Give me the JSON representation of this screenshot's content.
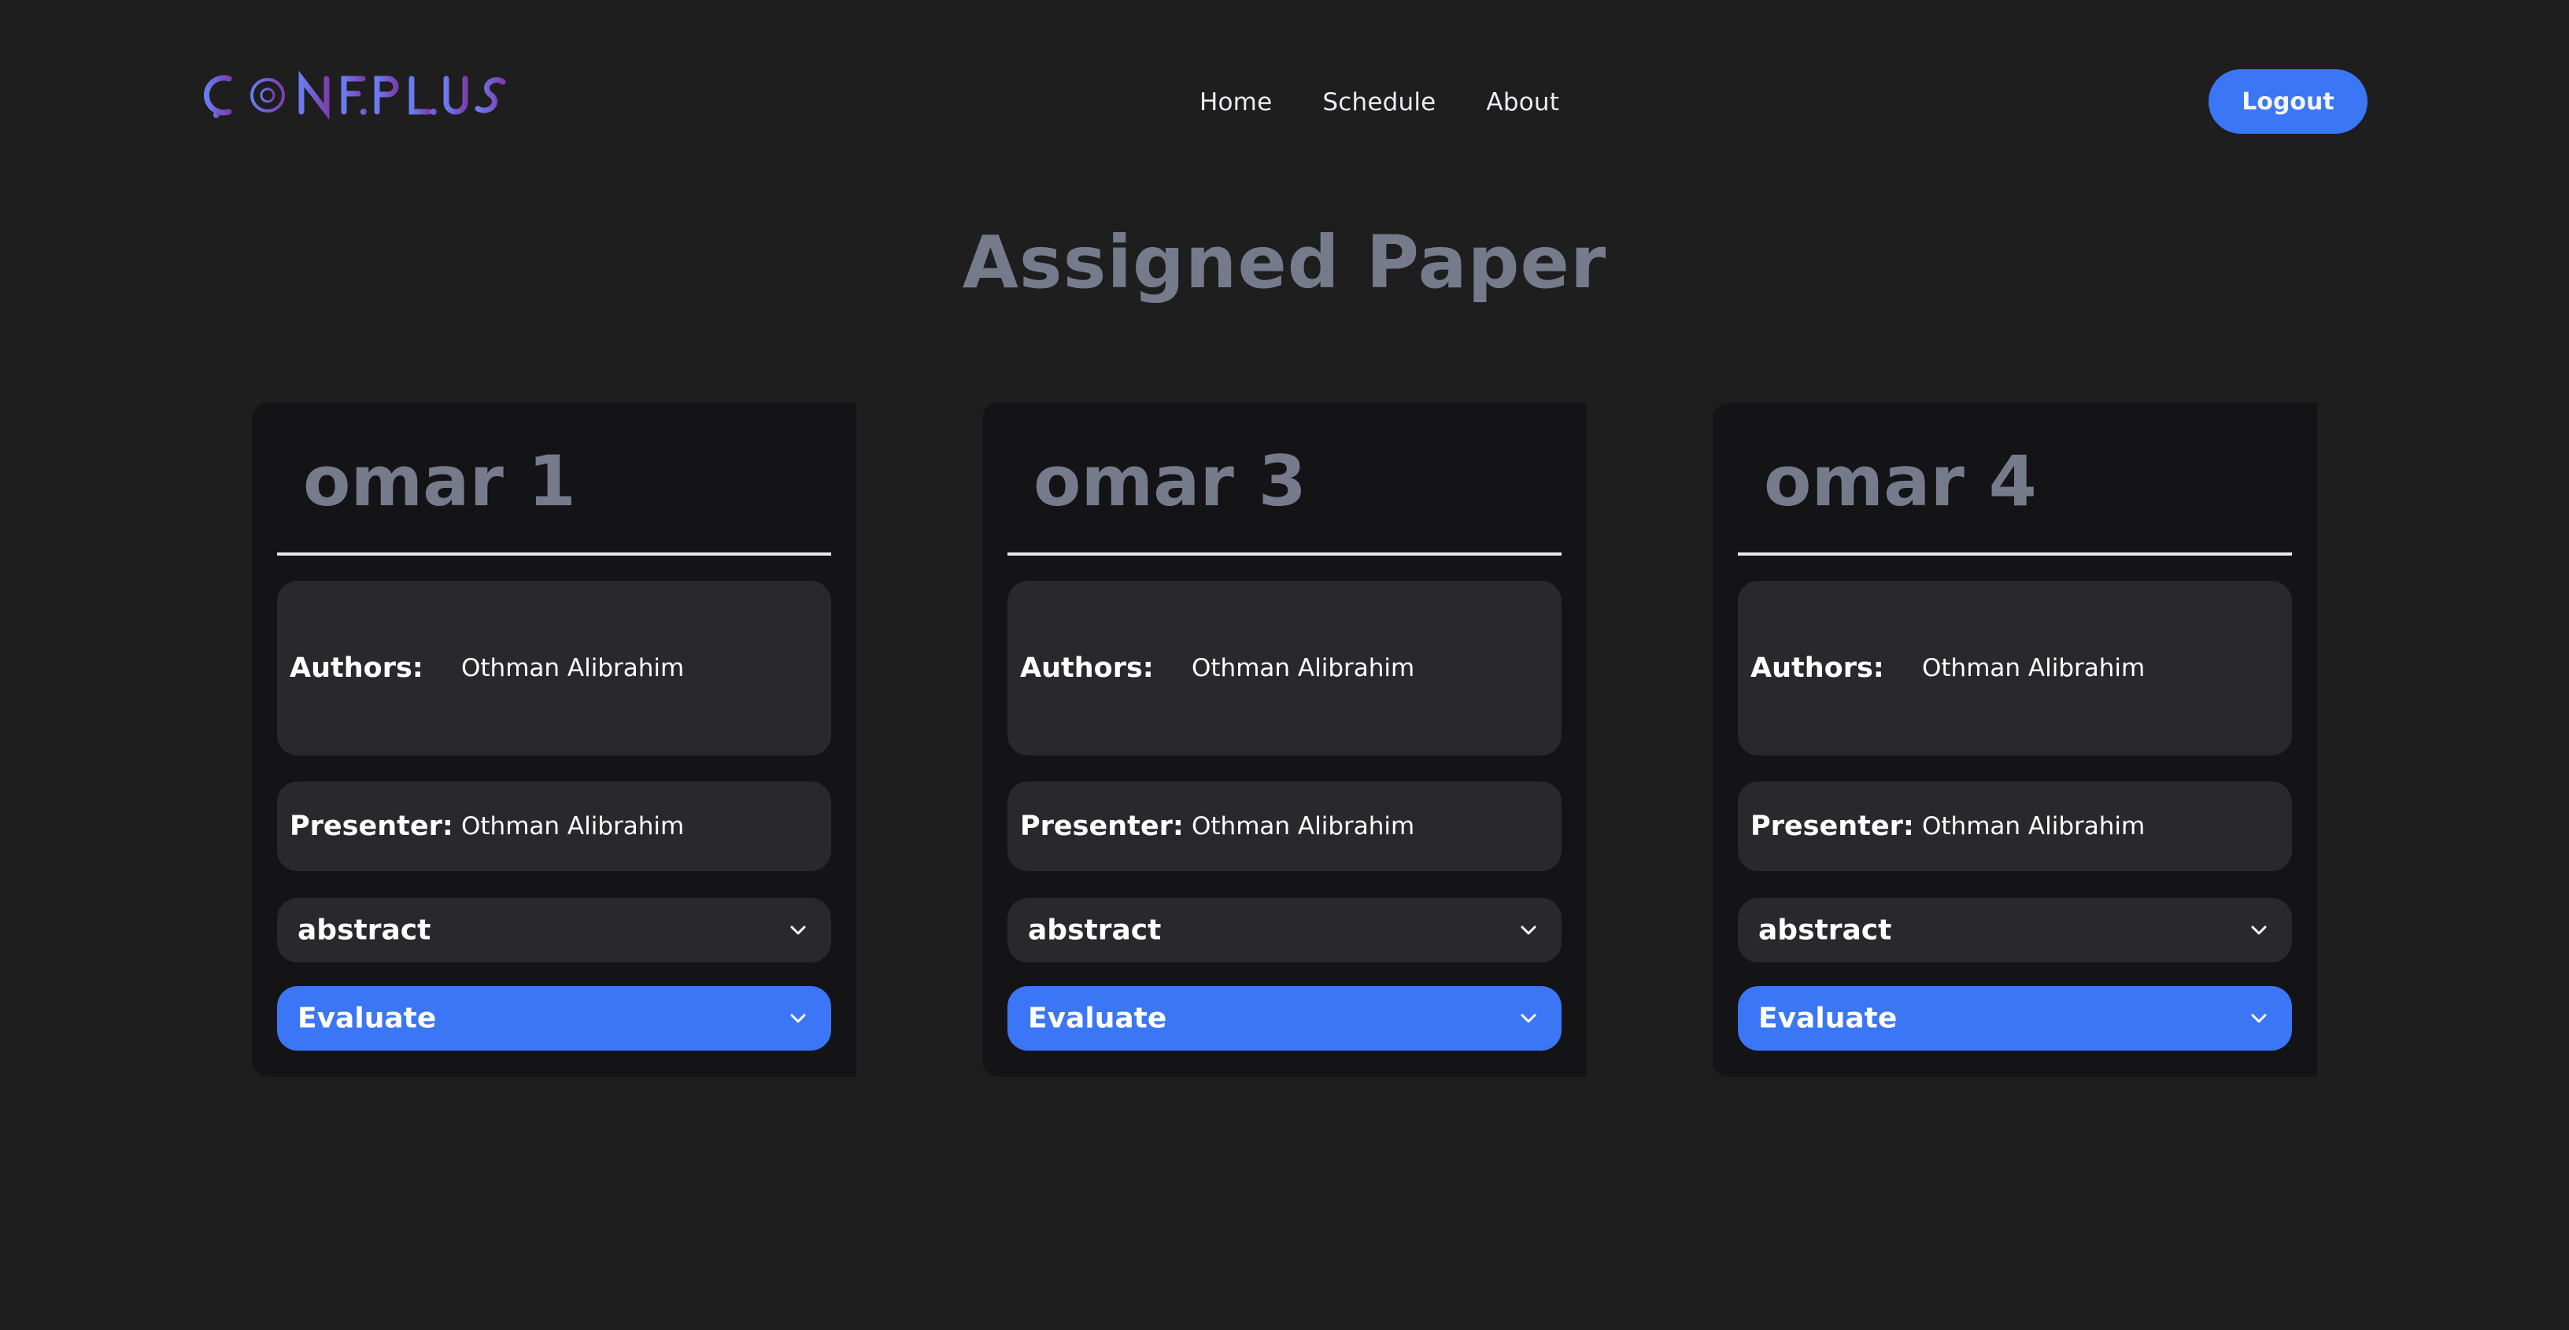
{
  "header": {
    "logo_text": "CONFPLUS",
    "nav": [
      {
        "label": "Home"
      },
      {
        "label": "Schedule"
      },
      {
        "label": "About"
      }
    ],
    "logout_label": "Logout"
  },
  "page_title": "Assigned Paper",
  "colors": {
    "background": "#1e1e1e",
    "card": "#141416",
    "field": "#29292d",
    "accent": "#3b76f6",
    "muted_title": "#767b8c"
  },
  "papers": [
    {
      "title": "omar 1",
      "authors_label": "Authors:",
      "authors": "Othman Alibrahim",
      "presenter_label": "Presenter:",
      "presenter": "Othman Alibrahim",
      "abstract_label": "abstract",
      "evaluate_label": "Evaluate"
    },
    {
      "title": "omar 3",
      "authors_label": "Authors:",
      "authors": "Othman Alibrahim",
      "presenter_label": "Presenter:",
      "presenter": "Othman Alibrahim",
      "abstract_label": "abstract",
      "evaluate_label": "Evaluate"
    },
    {
      "title": "omar 4",
      "authors_label": "Authors:",
      "authors": "Othman Alibrahim",
      "presenter_label": "Presenter:",
      "presenter": "Othman Alibrahim",
      "abstract_label": "abstract",
      "evaluate_label": "Evaluate"
    }
  ]
}
